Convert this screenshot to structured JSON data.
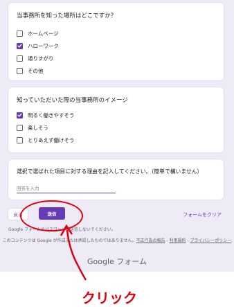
{
  "question1": {
    "title": "当事務所を知った場所はどこですか？",
    "options": [
      {
        "label": "ホームページ",
        "checked": false
      },
      {
        "label": "ハローワーク",
        "checked": true
      },
      {
        "label": "通りすがり",
        "checked": false
      },
      {
        "label": "その他",
        "checked": false
      }
    ]
  },
  "question2": {
    "title": "知っていただいた際の当事務所のイメージ",
    "options": [
      {
        "label": "明るく働きやすそう",
        "checked": true
      },
      {
        "label": "楽しそう",
        "checked": false
      },
      {
        "label": "とりあえず働けそう",
        "checked": false
      }
    ]
  },
  "question3": {
    "title": "選択で選ばれた項目に対する理由を記入してください。（簡単で構いません）",
    "placeholder": "回答を入力"
  },
  "buttons": {
    "back": "戻る",
    "send": "送信",
    "clear": "フォームをクリア"
  },
  "footer": {
    "password_note": "Google フォームでパスワードを送信しないでください。",
    "disclaimer": "このコンテンツは Google が作成または承認したものではありません。",
    "abuse_link": "不正行為の報告",
    "terms_link": "利用規約",
    "separator": " - ",
    "privacy_link": "プライバシーポリシー",
    "brand": "Google フォーム"
  },
  "annotation": {
    "label": "クリック",
    "color": "#e0000d"
  },
  "colors": {
    "accent": "#673ab7",
    "background": "#efebf6"
  }
}
